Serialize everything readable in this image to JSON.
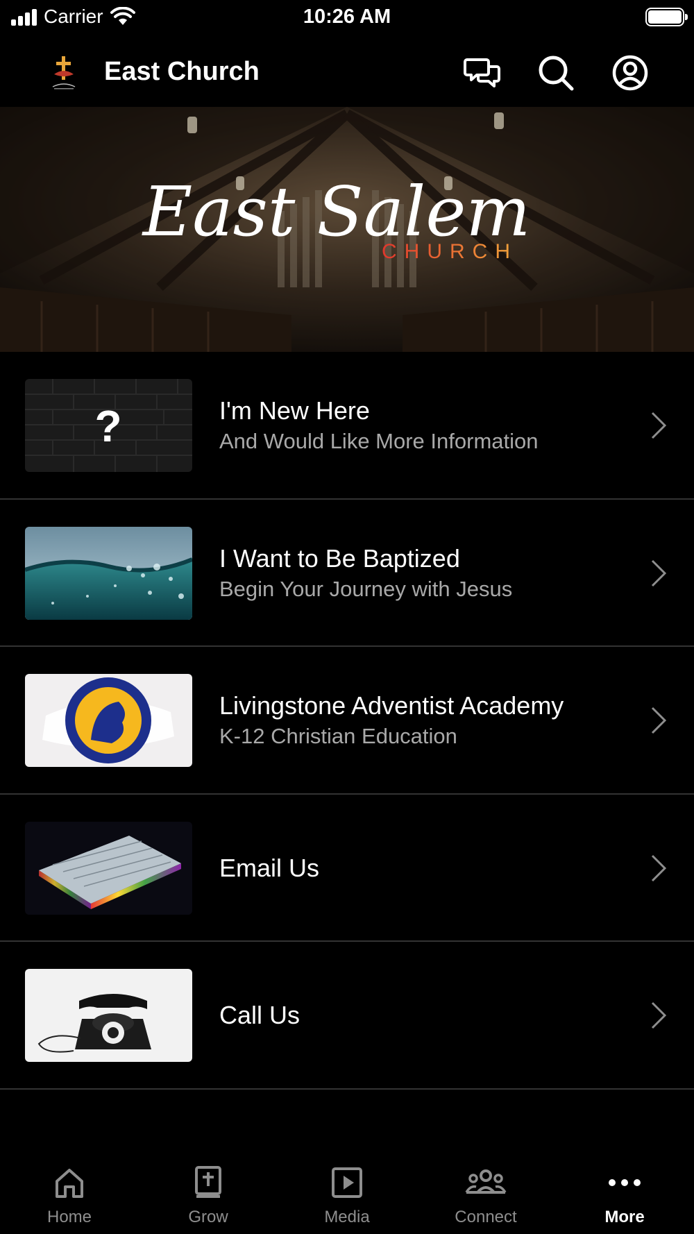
{
  "status_bar": {
    "carrier": "Carrier",
    "time": "10:26 AM"
  },
  "header": {
    "title": "East Church",
    "icons": [
      "chat-icon",
      "search-icon",
      "profile-icon"
    ]
  },
  "hero": {
    "script_text": "East Salem",
    "subtitle": "CHURCH"
  },
  "list": [
    {
      "title": "I'm New Here",
      "subtitle": "And Would Like More Information",
      "thumb_text": "?"
    },
    {
      "title": "I Want to Be Baptized",
      "subtitle": "Begin Your Journey with Jesus"
    },
    {
      "title": "Livingstone Adventist Academy",
      "subtitle": "K-12 Christian Education"
    },
    {
      "title": "Email Us",
      "subtitle": ""
    },
    {
      "title": "Call Us",
      "subtitle": ""
    }
  ],
  "tabs": [
    {
      "label": "Home",
      "icon": "home-icon"
    },
    {
      "label": "Grow",
      "icon": "bible-icon"
    },
    {
      "label": "Media",
      "icon": "play-icon"
    },
    {
      "label": "Connect",
      "icon": "people-icon"
    },
    {
      "label": "More",
      "icon": "more-icon",
      "active": true
    }
  ],
  "colors": {
    "background": "#000000",
    "subtitle_text": "#a9a9a9",
    "inactive_tab": "#8e8e8e",
    "church_gradient_start": "#e0362c",
    "church_gradient_end": "#f2a63b"
  }
}
